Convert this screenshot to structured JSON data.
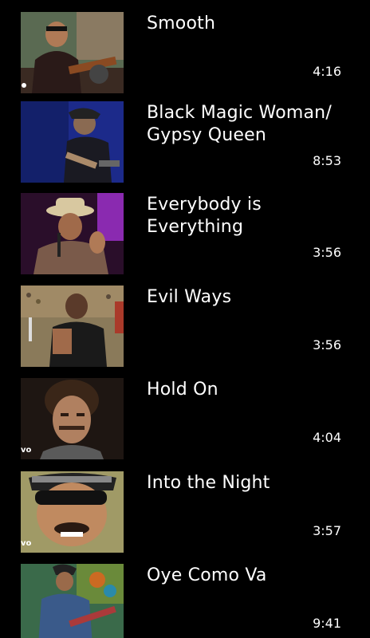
{
  "videos": [
    {
      "title": "Smooth",
      "duration": "4:16",
      "badge": ""
    },
    {
      "title": "Black Magic Woman/ Gypsy Queen",
      "duration": "8:53",
      "badge": ""
    },
    {
      "title": "Everybody is Everything",
      "duration": "3:56",
      "badge": ""
    },
    {
      "title": "Evil Ways",
      "duration": "3:56",
      "badge": ""
    },
    {
      "title": "Hold On",
      "duration": "4:04",
      "badge": "vo"
    },
    {
      "title": "Into the Night",
      "duration": "3:57",
      "badge": "vo"
    },
    {
      "title": "Oye Como Va",
      "duration": "9:41",
      "badge": ""
    }
  ],
  "colors": {
    "background": "#000000",
    "text": "#ffffff"
  }
}
